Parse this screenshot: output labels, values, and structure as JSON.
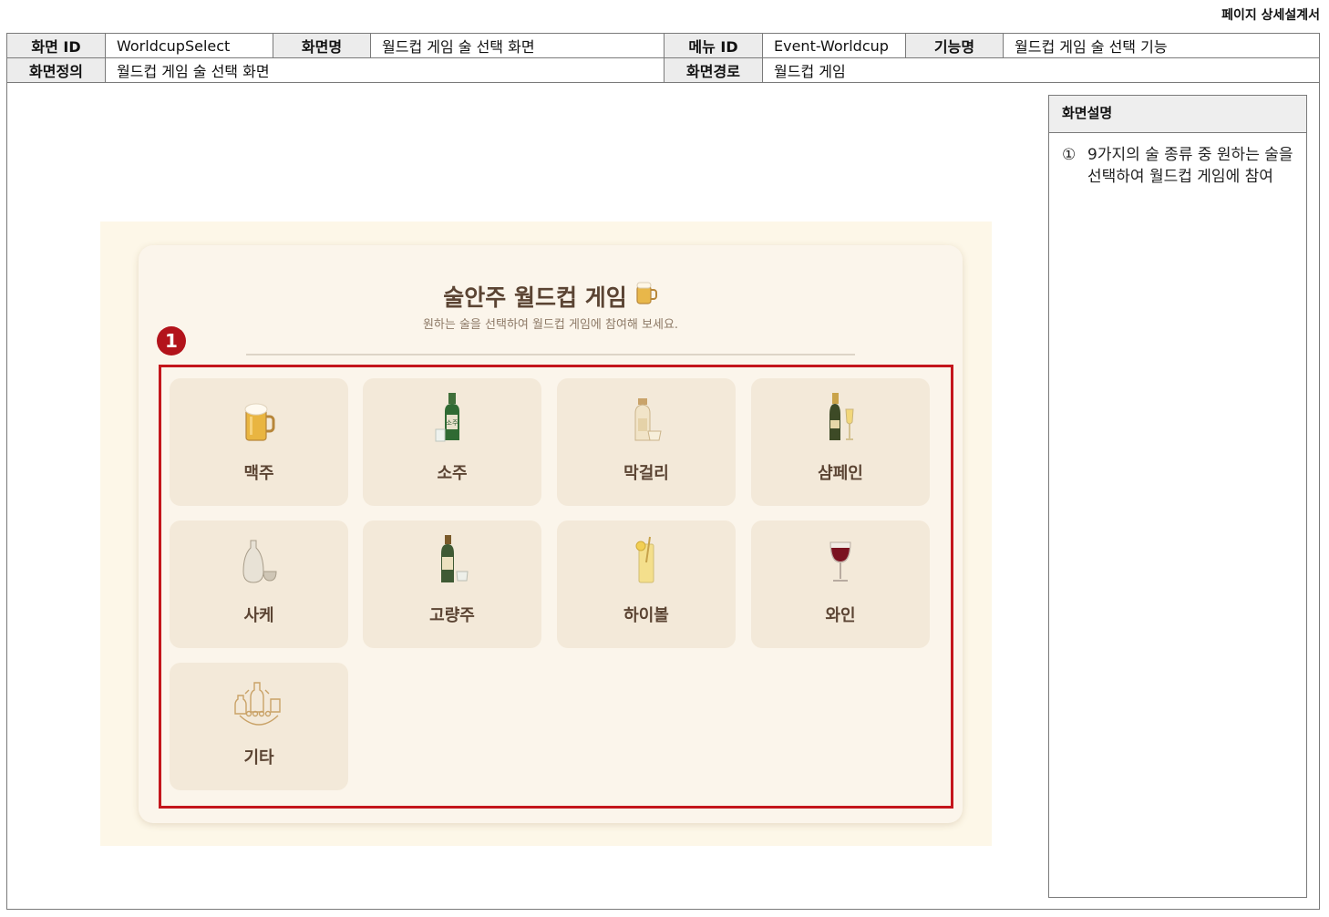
{
  "doc_title": "페이지 상세설계서",
  "header": {
    "screen_id_label": "화면 ID",
    "screen_id": "WorldcupSelect",
    "screen_name_label": "화면명",
    "screen_name": "월드컵 게임 술 선택 화면",
    "menu_id_label": "메뉴 ID",
    "menu_id": "Event-Worldcup",
    "function_label": "기능명",
    "function_name": "월드컵 게임 술 선택 기능",
    "definition_label": "화면정의",
    "definition": "월드컵 게임 술 선택 화면",
    "path_label": "화면경로",
    "path": "월드컵 게임"
  },
  "description": {
    "heading": "화면설명",
    "items": [
      {
        "num": "①",
        "text": "9가지의 술 종류 중 원하는 술을 선택하여 월드컵 게임에 참여"
      }
    ]
  },
  "mockup": {
    "title": "술안주 월드컵 게임",
    "title_icon": "beer-mug-icon",
    "subtitle": "원하는 술을 선택하여 월드컵 게임에 참여해 보세요.",
    "badge": "1",
    "drinks": [
      {
        "label": "맥주",
        "icon": "beer-icon"
      },
      {
        "label": "소주",
        "icon": "soju-icon"
      },
      {
        "label": "막걸리",
        "icon": "makgeolli-icon"
      },
      {
        "label": "샴페인",
        "icon": "champagne-icon"
      },
      {
        "label": "사케",
        "icon": "sake-icon"
      },
      {
        "label": "고량주",
        "icon": "goryangju-icon"
      },
      {
        "label": "하이볼",
        "icon": "highball-icon"
      },
      {
        "label": "와인",
        "icon": "wine-icon"
      },
      {
        "label": "기타",
        "icon": "etc-drinks-icon"
      }
    ]
  },
  "colors": {
    "accent_red": "#c4161c",
    "mock_bg": "#fdf7e8",
    "tile_bg": "#f3e9d9",
    "text_brown": "#5b4433"
  }
}
